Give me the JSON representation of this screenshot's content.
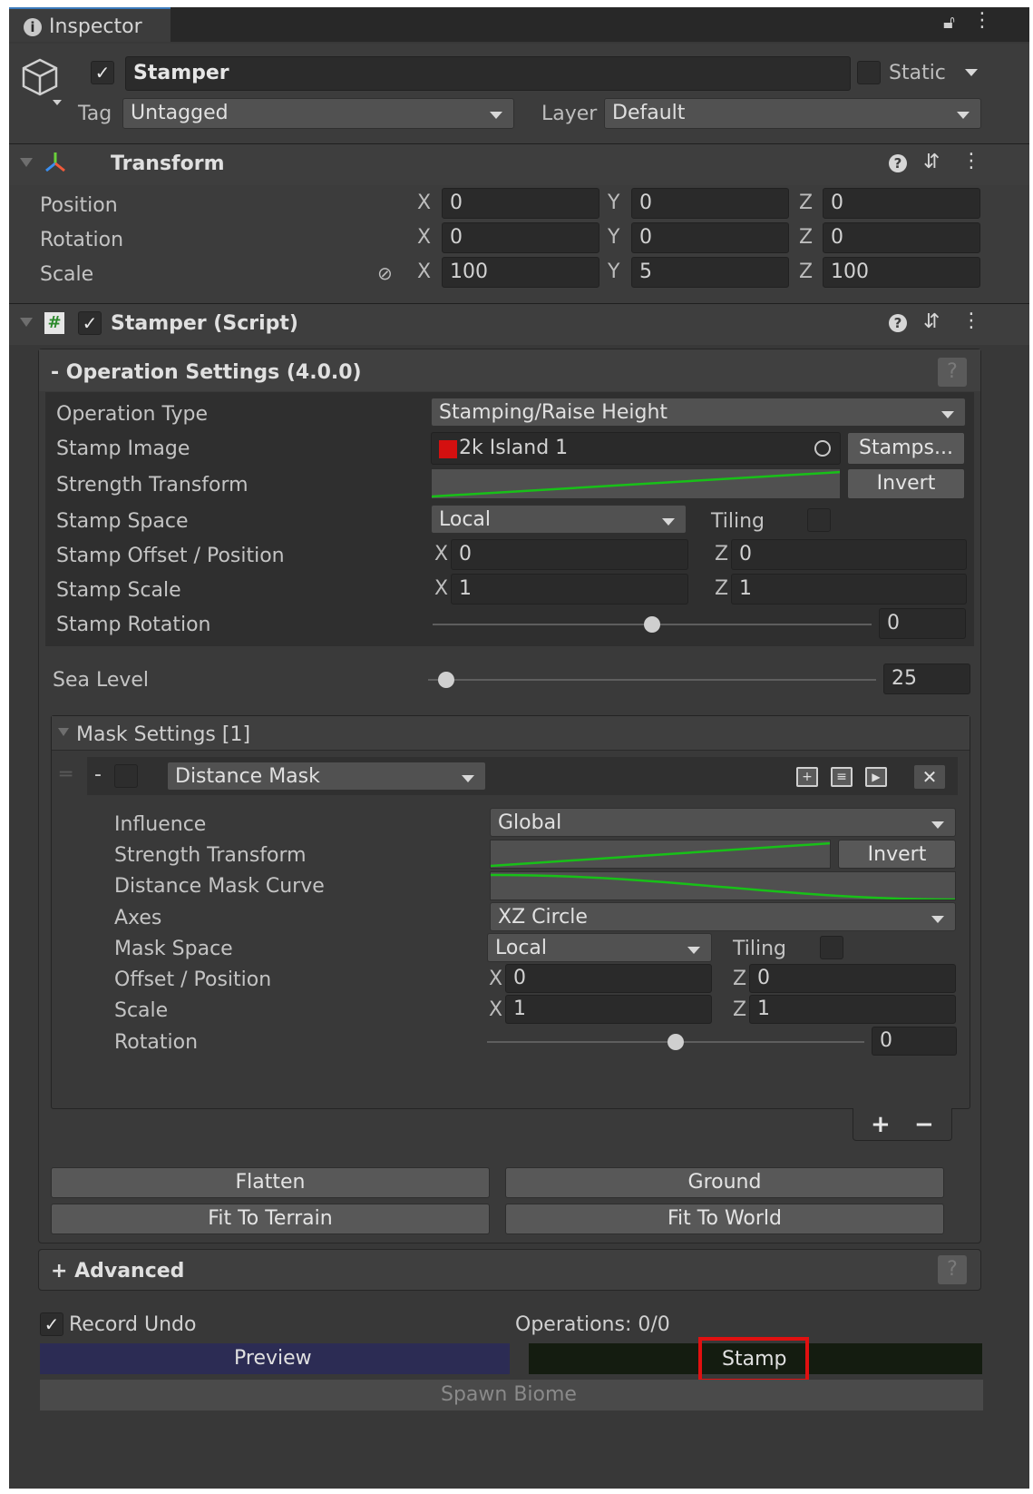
{
  "tab": {
    "title": "Inspector"
  },
  "object": {
    "name": "Stamper",
    "enabled": true,
    "static_label": "Static",
    "tag_label": "Tag",
    "tag_value": "Untagged",
    "layer_label": "Layer",
    "layer_value": "Default"
  },
  "transform": {
    "title": "Transform",
    "rows": [
      {
        "label": "Position",
        "x": "0",
        "y": "0",
        "z": "0"
      },
      {
        "label": "Rotation",
        "x": "0",
        "y": "0",
        "z": "0"
      },
      {
        "label": "Scale",
        "x": "100",
        "y": "5",
        "z": "100"
      }
    ],
    "axes": {
      "x": "X",
      "y": "Y",
      "z": "Z"
    }
  },
  "script": {
    "title": "Stamper (Script)",
    "enabled": true
  },
  "operation": {
    "title": "- Operation Settings  (4.0.0)",
    "help": "?",
    "type_label": "Operation Type",
    "type_value": "Stamping/Raise Height",
    "image_label": "Stamp Image",
    "image_value": "2k Island 1",
    "stamps_button": "Stamps...",
    "strength_label": "Strength Transform",
    "invert_button": "Invert",
    "space_label": "Stamp Space",
    "space_value": "Local",
    "tiling_label": "Tiling",
    "offset_label": "Stamp Offset / Position",
    "offset_x": "0",
    "offset_z": "0",
    "scale_label": "Stamp Scale",
    "scale_x": "1",
    "scale_z": "1",
    "rotation_label": "Stamp Rotation",
    "rotation_value": "0",
    "rotation_fraction": 0.5,
    "sea_label": "Sea Level",
    "sea_value": "25",
    "sea_fraction": 0.04
  },
  "mask": {
    "title": "Mask Settings [1]",
    "item_dash": "-",
    "item_type": "Distance Mask",
    "influence_label": "Influence",
    "influence_value": "Global",
    "strength_label": "Strength Transform",
    "invert_button": "Invert",
    "curve_label": "Distance Mask Curve",
    "axes_label": "Axes",
    "axes_value": "XZ Circle",
    "space_label": "Mask Space",
    "space_value": "Local",
    "tiling_label": "Tiling",
    "offset_label": "Offset / Position",
    "offset_x": "0",
    "offset_z": "0",
    "scale_label": "Scale",
    "scale_x": "1",
    "scale_z": "1",
    "rotation_label": "Rotation",
    "rotation_value": "0",
    "rotation_fraction": 0.5,
    "add": "+",
    "remove": "−"
  },
  "buttons": {
    "flatten": "Flatten",
    "ground": "Ground",
    "fit_terrain": "Fit To Terrain",
    "fit_world": "Fit To World"
  },
  "advanced": {
    "title": "+ Advanced",
    "help": "?"
  },
  "footer": {
    "record_undo": "Record Undo",
    "operations": "Operations: 0/0",
    "preview": "Preview",
    "stamp": "Stamp",
    "spawn_biome": "Spawn Biome"
  },
  "colors": {
    "panel": "#383838",
    "accent_curve": "#18c018",
    "preview_bg": "#2c2c54",
    "stamp_bg": "#141c10",
    "highlight": "#e01010"
  }
}
